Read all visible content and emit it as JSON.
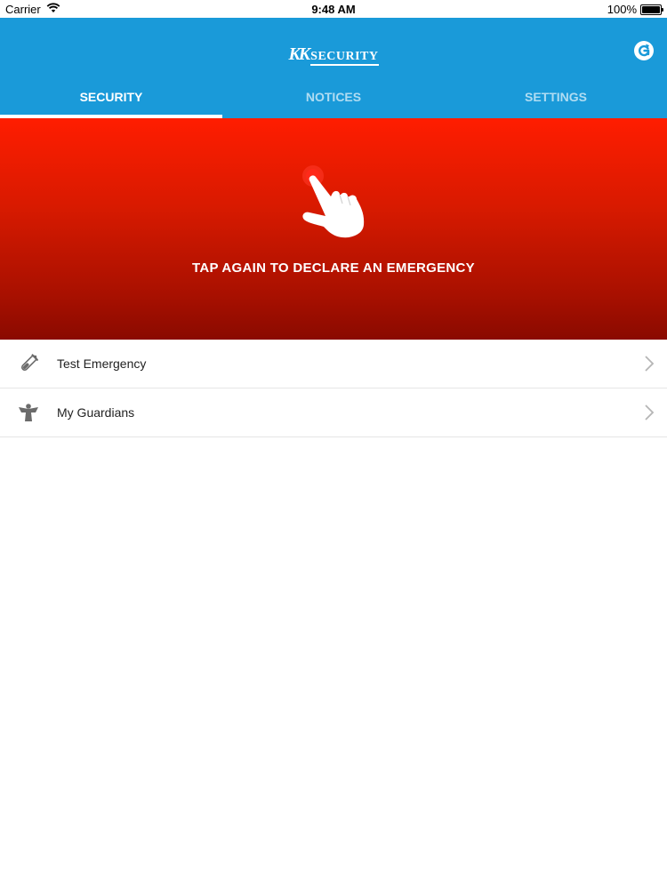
{
  "status_bar": {
    "carrier": "Carrier",
    "time": "9:48 AM",
    "battery": "100%",
    "battery_level": 1.0
  },
  "header": {
    "logo_mark": "KK",
    "logo_word": "SECURITY",
    "action_icon": "refresh-icon",
    "background_color": "#1a9ad9"
  },
  "tabs": [
    {
      "label": "SECURITY",
      "active": true
    },
    {
      "label": "NOTICES",
      "active": false
    },
    {
      "label": "SETTINGS",
      "active": false
    }
  ],
  "emergency": {
    "message": "TAP AGAIN TO DECLARE AN EMERGENCY",
    "icon": "tap-hand-icon",
    "color_top": "#ff1d00",
    "color_bottom": "#8a0a00"
  },
  "list": [
    {
      "label": "Test Emergency",
      "icon": "test-tube-icon"
    },
    {
      "label": "My Guardians",
      "icon": "guardian-angel-icon"
    }
  ]
}
